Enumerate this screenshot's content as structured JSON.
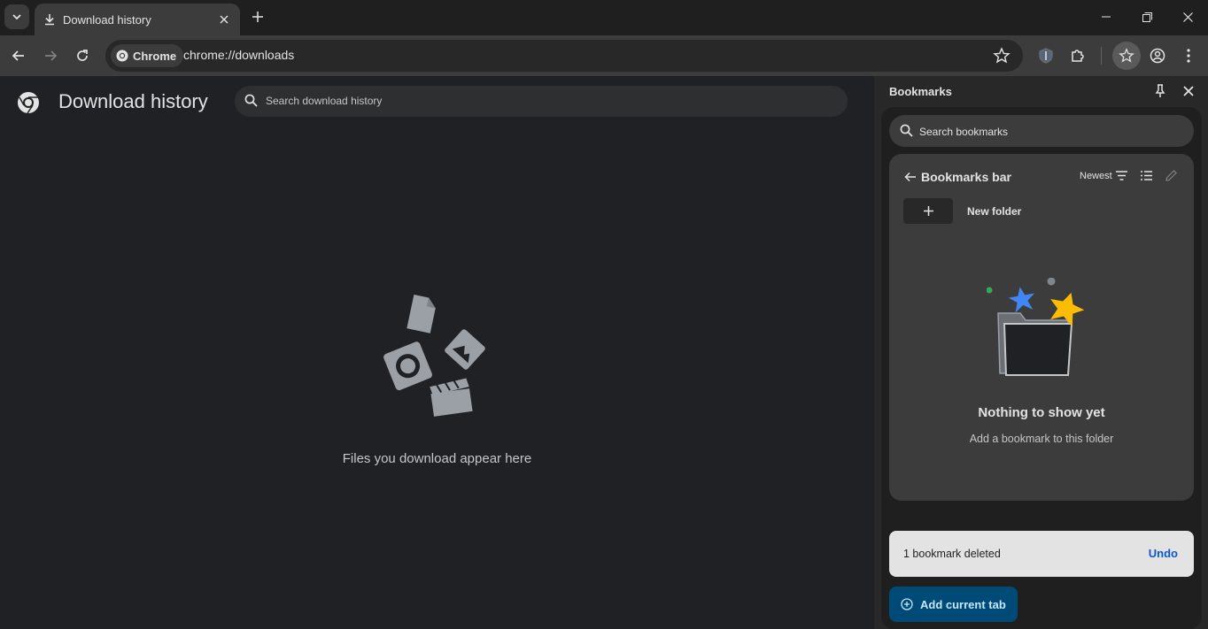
{
  "tab": {
    "title": "Download history"
  },
  "omnibox": {
    "chip_label": "Chrome",
    "url": "chrome://downloads"
  },
  "page": {
    "title": "Download history",
    "search_placeholder": "Search download history",
    "empty_text": "Files you download appear here"
  },
  "side_panel": {
    "title": "Bookmarks",
    "search_placeholder": "Search bookmarks",
    "folder_title": "Bookmarks bar",
    "sort_label": "Newest",
    "new_folder_label": "New folder",
    "empty_heading": "Nothing to show yet",
    "empty_sub": "Add a bookmark to this folder",
    "toast_text": "1 bookmark deleted",
    "toast_action": "Undo",
    "add_tab_label": "Add current tab"
  },
  "colors": {
    "accent_blue": "#0b57d0",
    "add_button_bg": "#004a77",
    "star_blue": "#4285f4",
    "star_yellow": "#fbbc04",
    "dot_green": "#34a853"
  },
  "icons": [
    "tab-search-icon",
    "download-icon",
    "close-icon",
    "plus-icon",
    "minimize-icon",
    "restore-icon",
    "back-icon",
    "forward-icon",
    "reload-icon",
    "chrome-icon",
    "star-icon",
    "shield-icon",
    "extensions-icon",
    "bookmarks-icon",
    "profile-icon",
    "menu-icon",
    "search-icon",
    "pin-icon",
    "sort-icon",
    "list-view-icon",
    "edit-icon",
    "add-circle-icon"
  ]
}
